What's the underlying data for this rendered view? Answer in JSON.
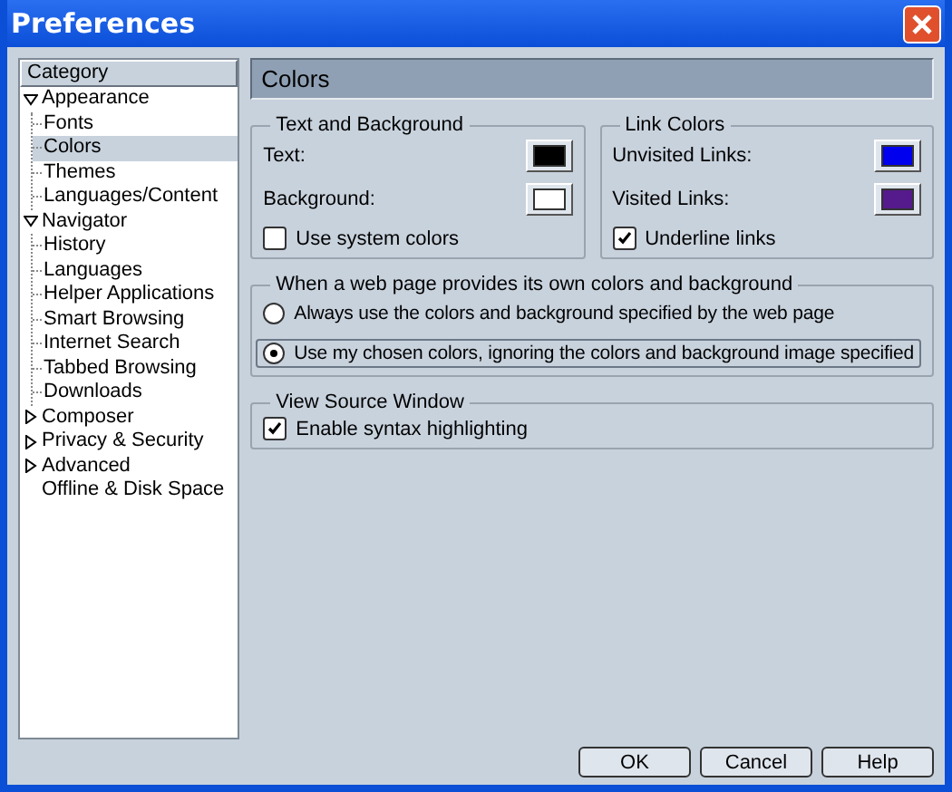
{
  "window": {
    "title": "Preferences"
  },
  "sidebar": {
    "header": "Category",
    "items": [
      {
        "label": "Appearance",
        "selected": false,
        "expanded": true,
        "children": [
          {
            "label": "Fonts",
            "selected": false
          },
          {
            "label": "Colors",
            "selected": true
          },
          {
            "label": "Themes",
            "selected": false
          },
          {
            "label": "Languages/Content",
            "selected": false
          }
        ]
      },
      {
        "label": "Navigator",
        "selected": false,
        "expanded": true,
        "children": [
          {
            "label": "History",
            "selected": false
          },
          {
            "label": "Languages",
            "selected": false
          },
          {
            "label": "Helper Applications",
            "selected": false
          },
          {
            "label": "Smart Browsing",
            "selected": false
          },
          {
            "label": "Internet Search",
            "selected": false
          },
          {
            "label": "Tabbed Browsing",
            "selected": false
          },
          {
            "label": "Downloads",
            "selected": false
          }
        ]
      },
      {
        "label": "Composer",
        "selected": false,
        "expanded": false
      },
      {
        "label": "Privacy & Security",
        "selected": false,
        "expanded": false
      },
      {
        "label": "Advanced",
        "selected": false,
        "expanded": false
      },
      {
        "label": "Offline & Disk Space",
        "selected": false
      }
    ]
  },
  "panel": {
    "title": "Colors",
    "text_and_background": {
      "legend": "Text and Background",
      "rows": [
        {
          "label": "Text:",
          "color": "#000000"
        },
        {
          "label": "Background:",
          "color": "#ffffff"
        }
      ],
      "checkbox": {
        "label": "Use system colors",
        "checked": false
      }
    },
    "link_colors": {
      "legend": "Link Colors",
      "rows": [
        {
          "label": "Unvisited Links:",
          "color": "#0000ee"
        },
        {
          "label": "Visited Links:",
          "color": "#551a8b"
        }
      ],
      "checkbox": {
        "label": "Underline links",
        "checked": true
      }
    },
    "page_colors": {
      "legend": "When a web page provides its own colors and background",
      "options": [
        {
          "label": "Always use the colors and background specified by the web page",
          "selected": false
        },
        {
          "label": "Use my chosen colors, ignoring the colors and background image specified",
          "selected": true
        }
      ]
    },
    "view_source": {
      "legend": "View Source Window",
      "checkbox": {
        "label": "Enable syntax highlighting",
        "checked": true
      }
    }
  },
  "buttons": [
    "OK",
    "Cancel",
    "Help"
  ]
}
